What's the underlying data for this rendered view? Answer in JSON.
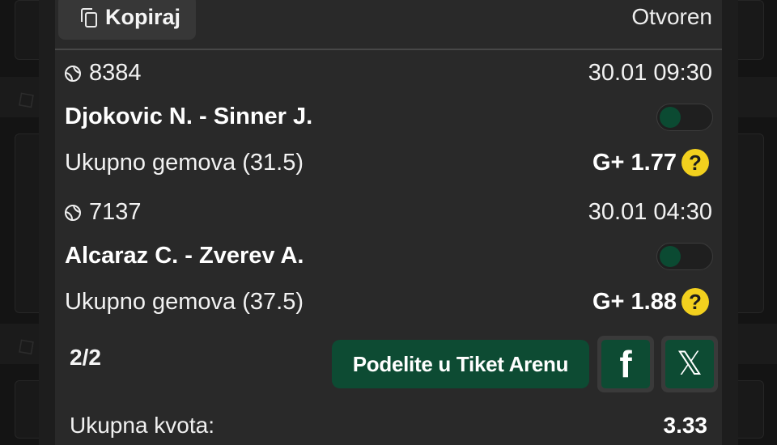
{
  "header": {
    "copy_label": "Kopiraj",
    "status": "Otvoren"
  },
  "matches": [
    {
      "id": "8384",
      "time": "30.01 09:30",
      "title": "Djokovic N. - Sinner J.",
      "market": "Ukupno gemova (31.5)",
      "odd": "G+ 1.77",
      "help": "?"
    },
    {
      "id": "7137",
      "time": "30.01 04:30",
      "title": "Alcaraz C. - Zverev A.",
      "market": "Ukupno gemova (37.5)",
      "odd": "G+ 1.88",
      "help": "?"
    }
  ],
  "footer": {
    "count": "2/2",
    "share_label": "Podelite u Tiket Arenu",
    "facebook_glyph": "f",
    "x_glyph": "𝕏",
    "total_label": "Ukupna kvota:",
    "total_value": "3.33"
  },
  "colors": {
    "accent_green": "#0d4b33",
    "help_yellow": "#f2d01e",
    "sheet_bg": "#292929"
  },
  "icons": [
    "copy-icon",
    "tennis-ball-icon",
    "help-icon",
    "facebook-icon",
    "x-logo-icon"
  ]
}
